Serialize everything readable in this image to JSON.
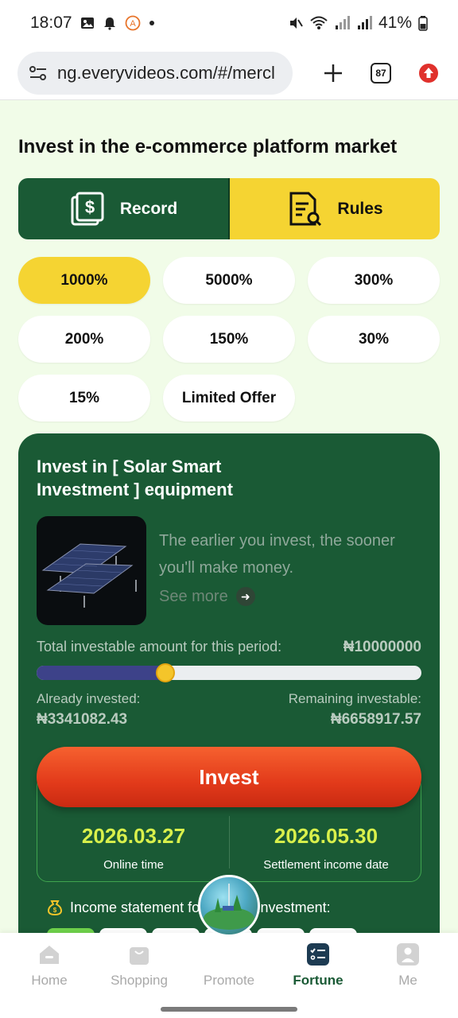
{
  "status_bar": {
    "time": "18:07",
    "battery": "41%"
  },
  "browser": {
    "url": "ng.everyvideos.com/#/mercl",
    "tab_count": "87"
  },
  "page": {
    "title": "Invest in the e-commerce platform market"
  },
  "tabs": {
    "record": "Record",
    "rules": "Rules"
  },
  "chips": [
    "1000%",
    "5000%",
    "300%",
    "200%",
    "150%",
    "30%",
    "15%",
    "Limited Offer"
  ],
  "card": {
    "title": "Invest in [ Solar Smart Investment ] equipment",
    "description": "The earlier you invest, the sooner you'll make money.",
    "see_more": "See more",
    "total_label": "Total investable amount for this period:",
    "total_value": "₦10000000",
    "progress_fraction": 0.334,
    "already_label": "Already invested:",
    "already_value": "₦3341082.43",
    "remaining_label": "Remaining investable:",
    "remaining_value": "₦6658917.57",
    "invest_button": "Invest",
    "online_time": "2026.03.27",
    "online_time_label": "Online time",
    "settlement_date": "2026.05.30",
    "settlement_label": "Settlement income date",
    "income_statement": "Income statement for today's investment:"
  },
  "nav": {
    "home": "Home",
    "shopping": "Shopping",
    "promote": "Promote",
    "fortune": "Fortune",
    "me": "Me"
  },
  "colors": {
    "card_green": "#1a5a35",
    "accent_yellow": "#f5d432",
    "invest_red": "#e23a1a",
    "date_yellow": "#d9f04b",
    "page_bg": "#f1fce8"
  }
}
